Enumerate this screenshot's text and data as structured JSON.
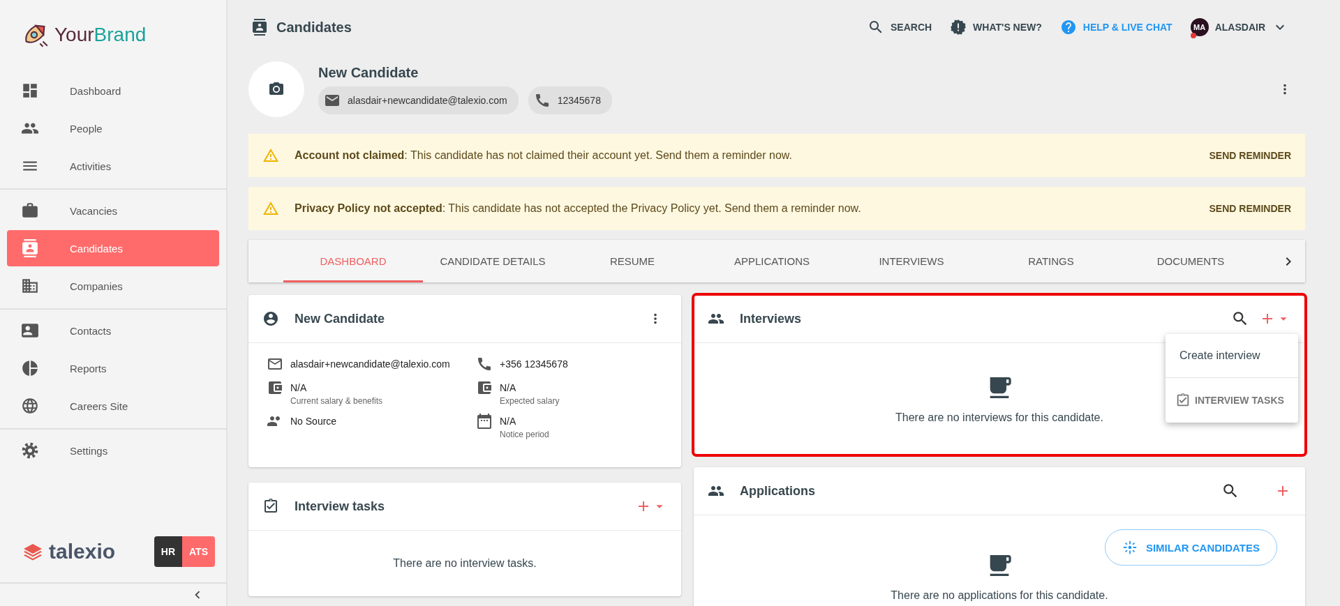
{
  "brand": {
    "first": "Your",
    "second": "Brand"
  },
  "sidebar": {
    "groups": [
      [
        {
          "kind": "dashboard",
          "label": "Dashboard",
          "selected": false
        },
        {
          "kind": "people",
          "label": "People",
          "selected": false
        },
        {
          "kind": "activities",
          "label": "Activities",
          "selected": false
        }
      ],
      [
        {
          "kind": "vacancies",
          "label": "Vacancies",
          "selected": false
        },
        {
          "kind": "candidates",
          "label": "Candidates",
          "selected": true
        },
        {
          "kind": "companies",
          "label": "Companies",
          "selected": false
        }
      ],
      [
        {
          "kind": "contacts",
          "label": "Contacts",
          "selected": false
        },
        {
          "kind": "reports",
          "label": "Reports",
          "selected": false
        },
        {
          "kind": "careers",
          "label": "Careers Site",
          "selected": false
        }
      ],
      [
        {
          "kind": "settings",
          "label": "Settings",
          "selected": false
        }
      ]
    ],
    "product_logo": "talexio",
    "modes": [
      {
        "label": "HR",
        "selected": false
      },
      {
        "label": "ATS",
        "selected": true
      }
    ]
  },
  "topbar": {
    "title": "Candidates",
    "actions": [
      {
        "kind": "search",
        "label": "SEARCH"
      },
      {
        "kind": "whats_new",
        "label": "WHAT'S NEW?"
      },
      {
        "kind": "help",
        "label": "HELP & LIVE CHAT"
      }
    ],
    "user": {
      "initials": "MA",
      "name": "ALASDAIR"
    }
  },
  "profile": {
    "name": "New Candidate",
    "email": "alasdair+newcandidate@talexio.com",
    "phone": "12345678"
  },
  "alerts": [
    {
      "text": "**Account not claimed**: This candidate has not claimed their account yet. Send them a reminder now.",
      "action": "SEND REMINDER"
    },
    {
      "text": "**Privacy Policy not accepted**: This candidate has not accepted the Privacy Policy yet. Send them a reminder now.",
      "action": "SEND REMINDER"
    }
  ],
  "tabs": [
    {
      "label": "DASHBOARD",
      "selected": true
    },
    {
      "label": "CANDIDATE DETAILS",
      "selected": false
    },
    {
      "label": "RESUME",
      "selected": false
    },
    {
      "label": "APPLICATIONS",
      "selected": false
    },
    {
      "label": "INTERVIEWS",
      "selected": false
    },
    {
      "label": "RATINGS",
      "selected": false
    },
    {
      "label": "DOCUMENTS",
      "selected": false
    }
  ],
  "candidate_card": {
    "title": "New Candidate",
    "details": [
      {
        "kind": "email",
        "value": "alasdair+newcandidate@talexio.com"
      },
      {
        "kind": "phone",
        "value": "+356 12345678"
      },
      {
        "kind": "wallet",
        "value": "N/A",
        "caption": "Current salary & benefits"
      },
      {
        "kind": "wallet",
        "value": "N/A",
        "caption": "Expected salary"
      },
      {
        "kind": "source",
        "value": "No Source"
      },
      {
        "kind": "calendar",
        "value": "N/A",
        "caption": "Notice period"
      }
    ]
  },
  "interview_tasks_card": {
    "title": "Interview tasks",
    "empty_text": "There are no interview tasks."
  },
  "interviews_card": {
    "title": "Interviews",
    "highlighted": true,
    "empty_text": "There are no interviews for this candidate.",
    "menu": [
      {
        "kind": "plain",
        "label": "Create interview"
      },
      {
        "kind": "tasks",
        "label": "INTERVIEW TASKS"
      }
    ]
  },
  "applications_card": {
    "title": "Applications",
    "empty_text": "There are no applications for this candidate.",
    "similar_button": "SIMILAR CANDIDATES"
  }
}
